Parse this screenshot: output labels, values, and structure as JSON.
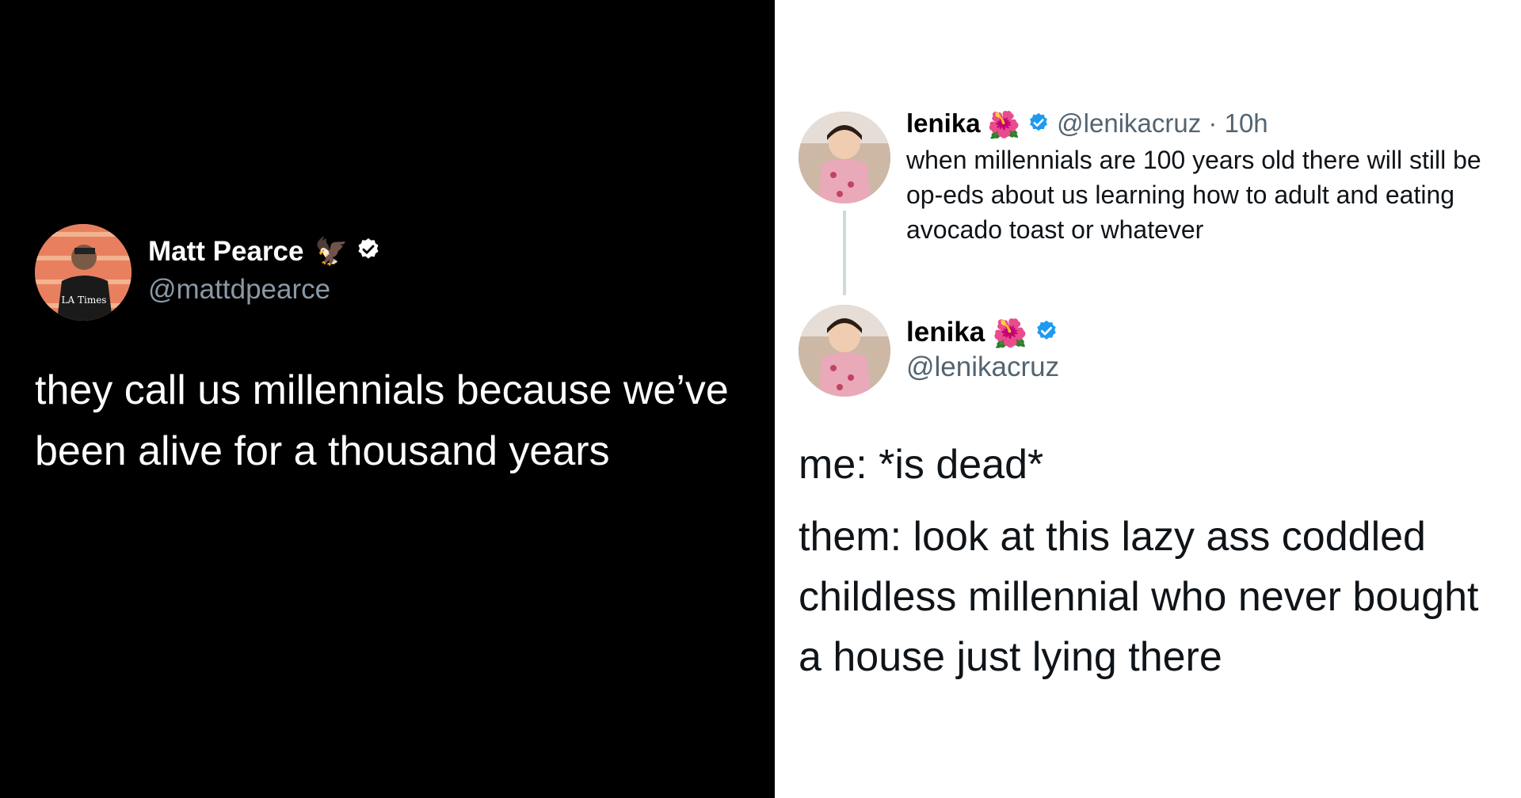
{
  "left_tweet": {
    "name": "Matt Pearce",
    "name_emoji": "🦅",
    "handle": "@mattdpearce",
    "text": "they call us millennials because we’ve been alive for a thousand years",
    "avatar_logo": "LA Times"
  },
  "right_tweet_1": {
    "name": "lenika",
    "name_emoji": "🌺",
    "handle": "@lenikacruz",
    "separator": "·",
    "time": "10h",
    "text": "when millennials are 100 years old there will still be op-eds about us learning how to adult and eating avocado toast or whatever"
  },
  "right_tweet_2": {
    "name": "lenika",
    "name_emoji": "🌺",
    "handle": "@lenikacruz",
    "line1": "me: *is dead*",
    "line2": "them: look at this lazy ass coddled childless millennial who never bought a house just lying there"
  },
  "colors": {
    "left_bg": "#000000",
    "right_bg": "#ffffff",
    "verified_blue": "#1d9bf0"
  },
  "icons": [
    "verified-icon",
    "eagle-emoji",
    "hibiscus-emoji"
  ]
}
